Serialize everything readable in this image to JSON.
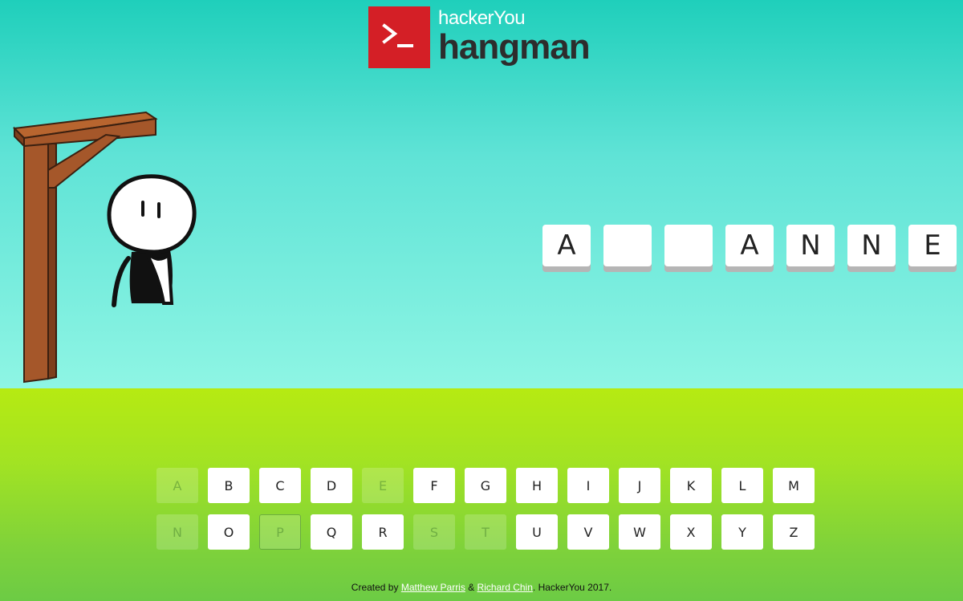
{
  "header": {
    "logo_glyph": ">_",
    "brand": "hackerYou",
    "title": "hangman",
    "brand_color": "#d41f26"
  },
  "game": {
    "word_tiles": [
      "A",
      "",
      "",
      "A",
      "N",
      "N",
      "E"
    ],
    "keyboard": [
      {
        "letter": "A",
        "used": true
      },
      {
        "letter": "B",
        "used": false
      },
      {
        "letter": "C",
        "used": false
      },
      {
        "letter": "D",
        "used": false
      },
      {
        "letter": "E",
        "used": true
      },
      {
        "letter": "F",
        "used": false
      },
      {
        "letter": "G",
        "used": false
      },
      {
        "letter": "H",
        "used": false
      },
      {
        "letter": "I",
        "used": false
      },
      {
        "letter": "J",
        "used": false
      },
      {
        "letter": "K",
        "used": false
      },
      {
        "letter": "L",
        "used": false
      },
      {
        "letter": "M",
        "used": false
      },
      {
        "letter": "N",
        "used": true
      },
      {
        "letter": "O",
        "used": false
      },
      {
        "letter": "P",
        "used": true
      },
      {
        "letter": "Q",
        "used": false
      },
      {
        "letter": "R",
        "used": false
      },
      {
        "letter": "S",
        "used": true
      },
      {
        "letter": "T",
        "used": true
      },
      {
        "letter": "U",
        "used": false
      },
      {
        "letter": "V",
        "used": false
      },
      {
        "letter": "W",
        "used": false
      },
      {
        "letter": "X",
        "used": false
      },
      {
        "letter": "Y",
        "used": false
      },
      {
        "letter": "Z",
        "used": false
      }
    ],
    "hangman_parts_shown": [
      "head",
      "body",
      "left-arm"
    ]
  },
  "footer": {
    "prefix": "Created by ",
    "author1": "Matthew Parris",
    "amp": " & ",
    "author2": "Richard Chin",
    "suffix": ". HackerYou 2017."
  }
}
